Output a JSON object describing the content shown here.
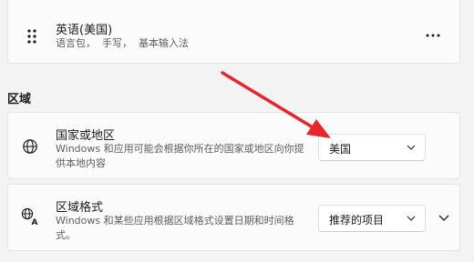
{
  "language_item": {
    "title": "英语(美国)",
    "description": "语言包，  手写，  基本输入法",
    "drag_icon": "drag-handle-icon",
    "more_icon": "more-options-icon"
  },
  "region_section": {
    "heading": "区域"
  },
  "country_setting": {
    "icon": "globe-icon",
    "title": "国家或地区",
    "description_line1": "Windows 和应用可能会根据你所在的国家或地区向你提",
    "description_line2": "供本地内容",
    "selected_value": "美国"
  },
  "format_setting": {
    "icon": "regional-format-icon",
    "title": "区域格式",
    "description_line1": "Windows 和某些应用根据区域格式设置日期和时间格",
    "description_line2": "式。",
    "selected_value": "推荐的项目"
  },
  "colors": {
    "annotation_arrow": "#e8262a",
    "card_background": "#fbfbfb",
    "page_background": "#f3f3f3"
  }
}
